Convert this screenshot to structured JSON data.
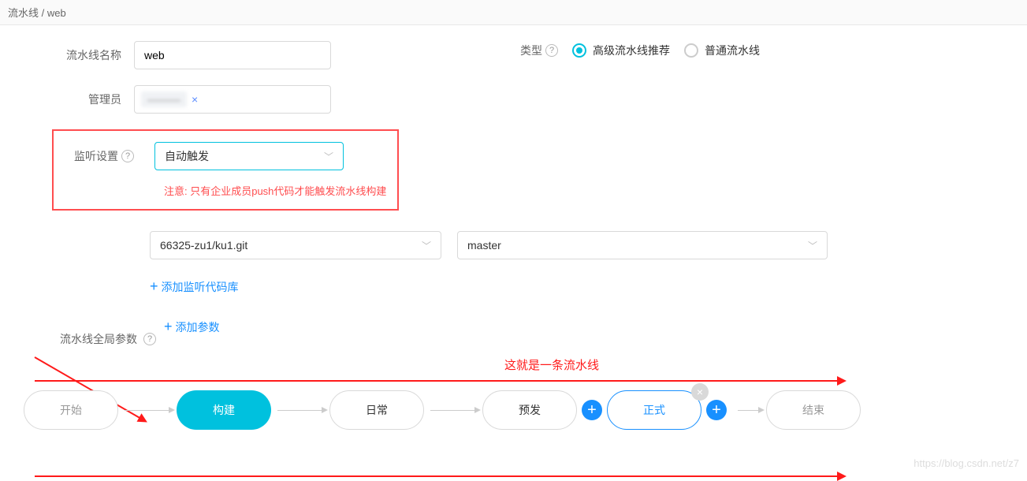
{
  "breadcrumb": {
    "root": "流水线",
    "sep": "/",
    "current": "web"
  },
  "form": {
    "nameLabel": "流水线名称",
    "nameValue": "web",
    "adminLabel": "管理员",
    "adminTag": "———",
    "listenLabel": "监听设置",
    "listenValue": "自动触发",
    "warnText": "注意: 只有企业成员push代码才能触发流水线构建",
    "repoValue": "66325-zu1/ku1.git",
    "branchValue": "master",
    "addRepoLabel": "添加监听代码库",
    "globalParamsLabel": "流水线全局参数",
    "addParamsLabel": "添加参数"
  },
  "type": {
    "label": "类型",
    "opt1": "高级流水线推荐",
    "opt2": "普通流水线"
  },
  "annotation": "这就是一条流水线",
  "pipeline": {
    "start": "开始",
    "build": "构建",
    "daily": "日常",
    "pre": "预发",
    "prod": "正式",
    "end": "结束"
  },
  "watermark": "https://blog.csdn.net/z7",
  "glyph": {
    "plus": "+",
    "times": "×",
    "chevron": "﹀",
    "help": "?",
    "arrow": "→"
  }
}
